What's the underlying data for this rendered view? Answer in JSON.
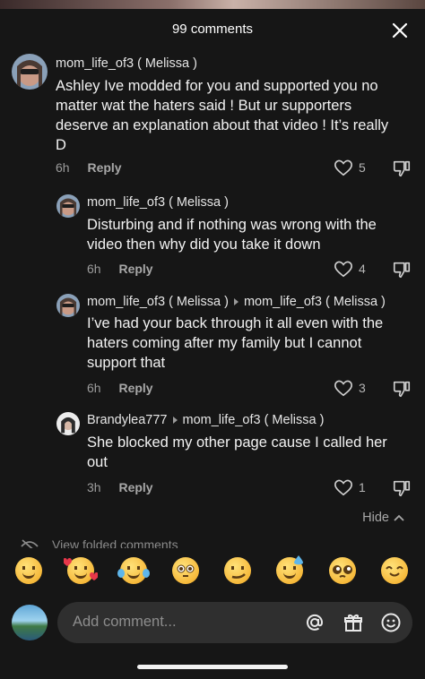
{
  "header": {
    "title": "99 comments"
  },
  "comments": [
    {
      "author": "mom_life_of3 ( Melissa )",
      "text_lines": [
        "Ashley Ive modded for you and supported you no",
        "matter wat the haters said ! But ur supporters",
        "deserve an explanation about that video ! It’s really",
        "D"
      ],
      "time": "6h",
      "reply": "Reply",
      "likes": "5"
    },
    {
      "author": "mom_life_of3 ( Melissa )",
      "text_lines": [
        "Disturbing and if nothing was wrong with the",
        "video then why did you take it down"
      ],
      "time": "6h",
      "reply": "Reply",
      "likes": "4"
    },
    {
      "author": "mom_life_of3 ( Melissa )",
      "reply_to": "mom_life_of3 ( Melissa )",
      "text_lines": [
        "I’ve had your back through it all even with the",
        "haters coming after my family but I cannot",
        "support that"
      ],
      "time": "6h",
      "reply": "Reply",
      "likes": "3"
    },
    {
      "author": "Brandylea777",
      "reply_to": "mom_life_of3 ( Melissa )",
      "text_lines": [
        "She blocked my other page cause I called her",
        "out"
      ],
      "time": "3h",
      "reply": "Reply",
      "likes": "1"
    }
  ],
  "hide_label": "Hide",
  "folded_label": "View folded comments",
  "emojis": [
    "grin",
    "smiling-hearts",
    "tears-of-joy",
    "flushed",
    "smirk",
    "cold-sweat",
    "pleading",
    "blush"
  ],
  "input": {
    "placeholder": "Add comment..."
  }
}
